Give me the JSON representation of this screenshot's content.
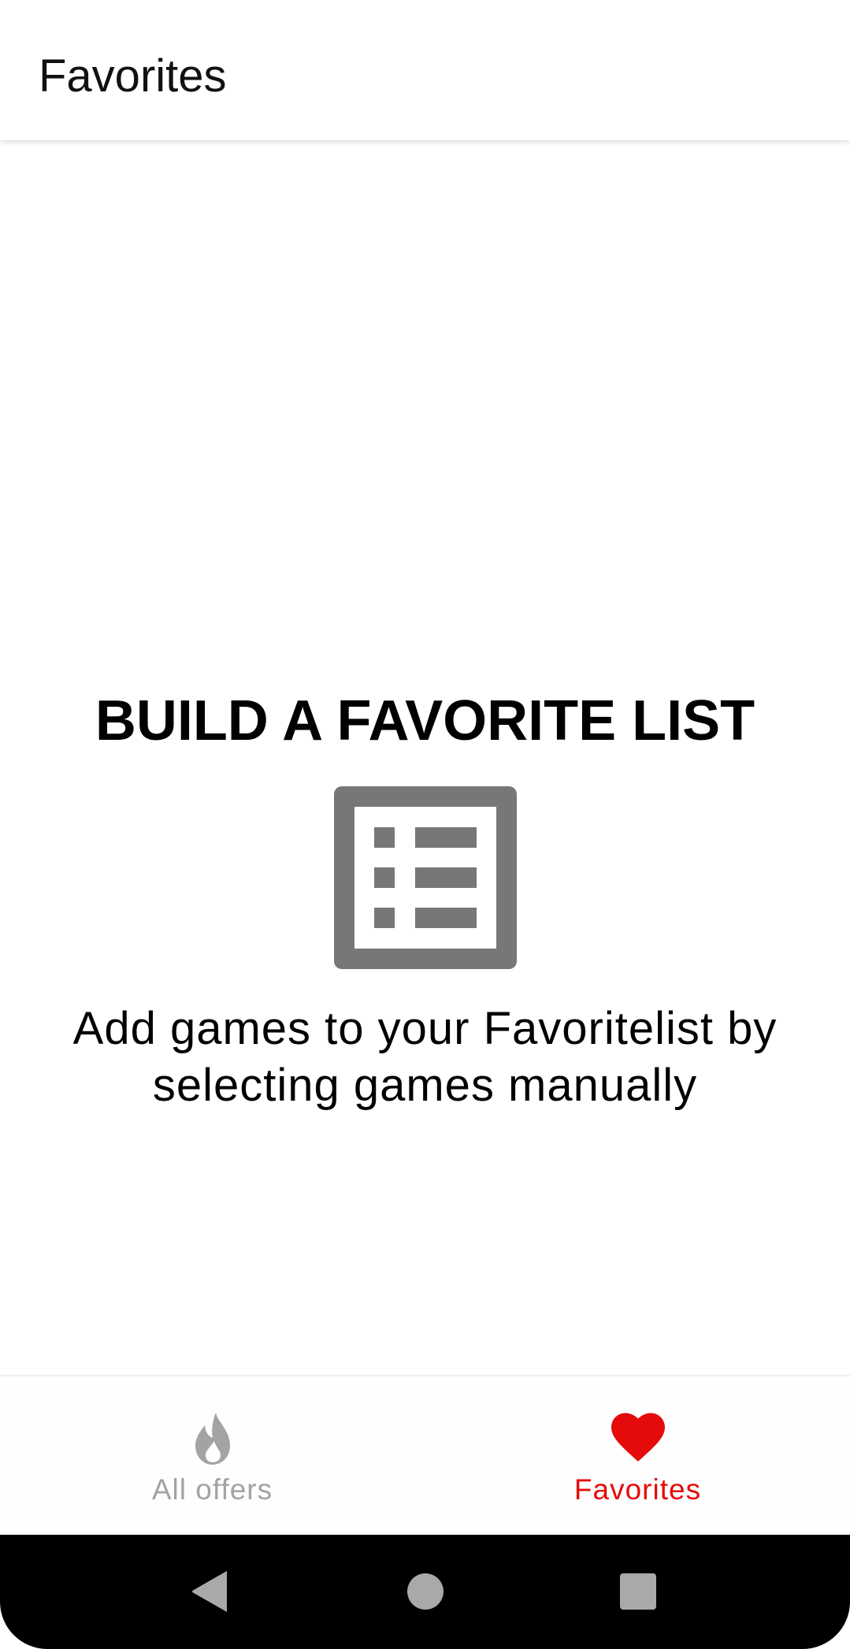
{
  "header": {
    "title": "Favorites"
  },
  "empty_state": {
    "heading": "BUILD A FAVORITE LIST",
    "icon": "list-icon",
    "message": "Add games to your Favoritelist by selecting games manually"
  },
  "bottom_nav": {
    "items": [
      {
        "label": "All offers",
        "icon": "flame-icon",
        "active": false
      },
      {
        "label": "Favorites",
        "icon": "heart-icon",
        "active": true
      }
    ]
  },
  "colors": {
    "accent": "#e60b0b",
    "inactive": "#a3a3a3",
    "icon_gray": "#777777",
    "text": "#000000",
    "system_bar": "#000000"
  },
  "system_nav": {
    "buttons": [
      "back-icon",
      "home-icon",
      "recents-icon"
    ]
  }
}
